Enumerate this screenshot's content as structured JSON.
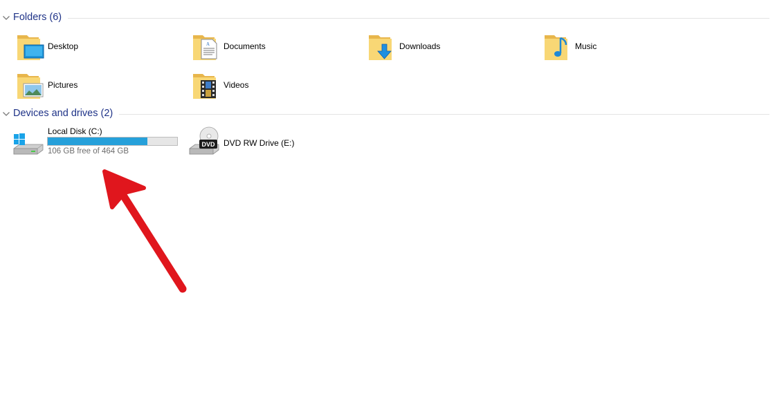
{
  "folders_group": {
    "title": "Folders (6)",
    "items": [
      {
        "label": "Desktop",
        "icon": "desktop-folder-icon"
      },
      {
        "label": "Documents",
        "icon": "documents-folder-icon"
      },
      {
        "label": "Downloads",
        "icon": "downloads-folder-icon"
      },
      {
        "label": "Music",
        "icon": "music-folder-icon"
      },
      {
        "label": "Pictures",
        "icon": "pictures-folder-icon"
      },
      {
        "label": "Videos",
        "icon": "videos-folder-icon"
      }
    ]
  },
  "drives_group": {
    "title": "Devices and drives (2)",
    "items": [
      {
        "label": "Local Disk (C:)",
        "icon": "local-disk-icon",
        "free_text": "106 GB free of 464 GB",
        "used_fraction": 0.77,
        "bar_color": "#26a0da"
      },
      {
        "label": "DVD RW Drive (E:)",
        "icon": "dvd-drive-icon",
        "badge": "DVD"
      }
    ]
  },
  "annotation": {
    "icon": "red-arrow-annotation",
    "color": "#e0161d"
  }
}
